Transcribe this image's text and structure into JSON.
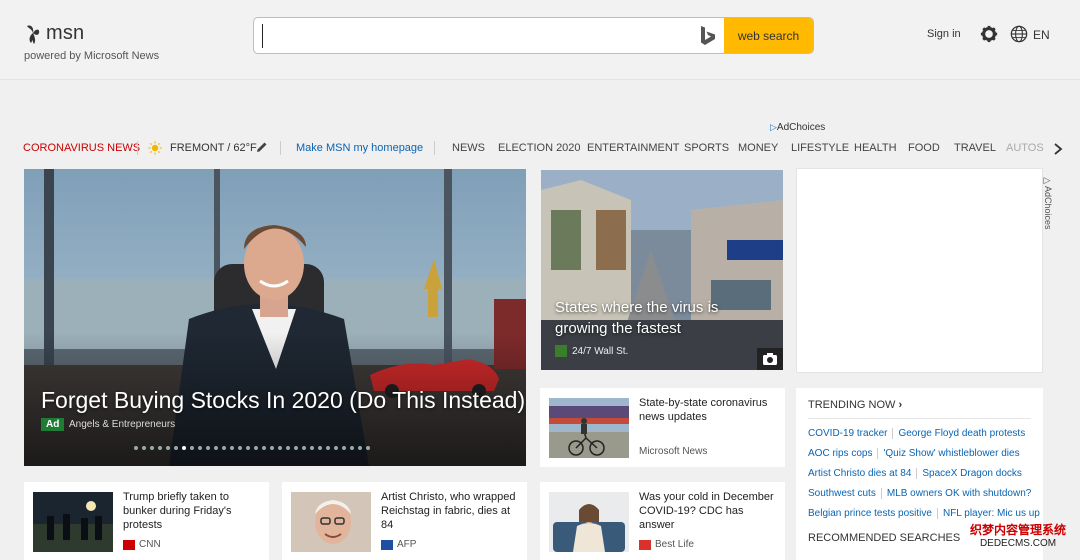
{
  "header": {
    "brand": "msn",
    "powered_by": "powered by Microsoft News",
    "search_value": "",
    "search_button": "web search",
    "sign_in": "Sign in",
    "lang": "EN"
  },
  "ad_choices": "AdChoices",
  "nav": {
    "coronavirus": "CORONAVIRUS NEWS",
    "weather": "FREMONT / 62°F",
    "make_homepage": "Make MSN my homepage",
    "categories": [
      "NEWS",
      "ELECTION 2020",
      "ENTERTAINMENT",
      "SPORTS",
      "MONEY",
      "LIFESTYLE",
      "HEALTH",
      "FOOD",
      "TRAVEL",
      "AUTOS"
    ]
  },
  "hero": {
    "title": "Forget Buying Stocks In 2020 (Do This Instead)",
    "badge": "Ad",
    "source": "Angels & Entrepreneurs",
    "slide_count": 30,
    "active_slide": 6
  },
  "feature": {
    "title": "States where the virus is growing the fastest",
    "source": "24/7 Wall St."
  },
  "cards": [
    {
      "title": "State-by-state coronavirus news updates",
      "source": "Microsoft News"
    },
    {
      "title": "Trump briefly taken to bunker during Friday's protests",
      "source": "CNN"
    },
    {
      "title": "Artist Christo, who wrapped Reichstag in fabric, dies at 84",
      "source": "AFP"
    },
    {
      "title": "Was your cold in December COVID-19? CDC has answer",
      "source": "Best Life"
    }
  ],
  "trending": {
    "heading": "TRENDING NOW",
    "rows": [
      [
        "COVID-19 tracker",
        "George Floyd death protests"
      ],
      [
        "AOC rips cops",
        "'Quiz Show' whistleblower dies"
      ],
      [
        "Artist Christo dies at 84",
        "SpaceX Dragon docks"
      ],
      [
        "Southwest cuts",
        "MLB owners OK with shutdown?"
      ],
      [
        "Belgian prince tests positive",
        "NFL player: Mic us up"
      ]
    ],
    "recommended": "RECOMMENDED SEARCHES"
  },
  "watermark": {
    "line1": "织梦内容管理系统",
    "line2": "DEDECMS.COM"
  },
  "colors": {
    "search_button": "#ffb900",
    "corona": "#cc0000",
    "link": "#0a64b4"
  }
}
